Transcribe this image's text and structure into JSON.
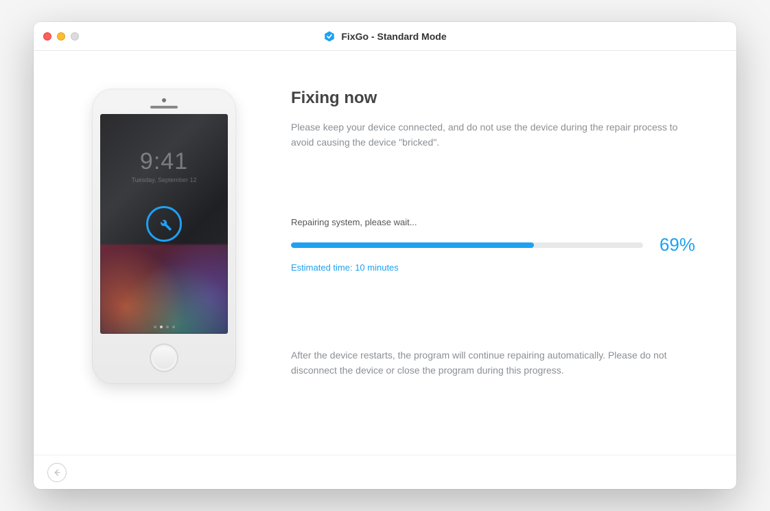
{
  "window": {
    "title": "FixGo - Standard Mode"
  },
  "phone": {
    "lock_time": "9:41",
    "lock_date": "Tuesday, September 12"
  },
  "main": {
    "heading": "Fixing now",
    "description": "Please keep your device connected, and do not use the device during the repair process to avoid causing the device \"bricked\"."
  },
  "progress": {
    "status_label": "Repairing system, please wait...",
    "percent_value": 69,
    "percent_display": "69%",
    "estimated_label": "Estimated time: 10 minutes"
  },
  "footer": {
    "note": "After the device restarts, the program will continue repairing automatically. Please do not disconnect the device or close the program during this progress."
  }
}
